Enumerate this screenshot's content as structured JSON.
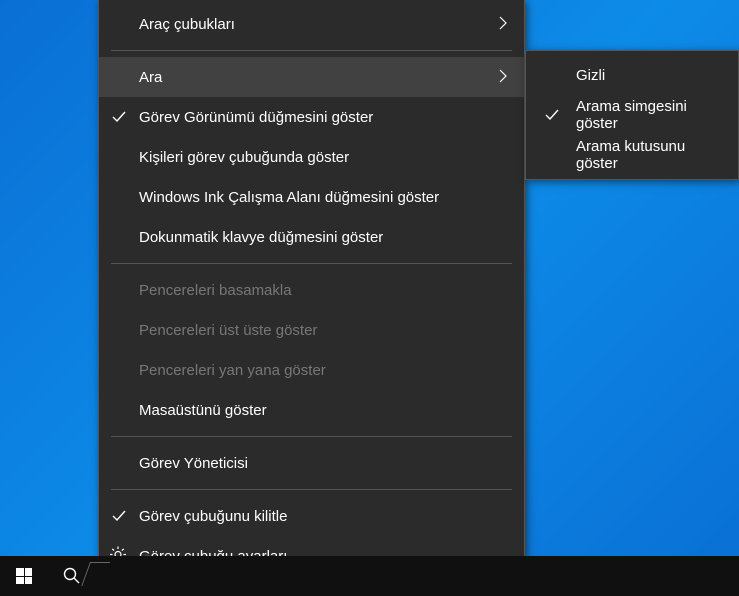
{
  "mainMenu": {
    "toolbars": "Araç çubukları",
    "search": "Ara",
    "showTaskView": "Görev Görünümü düğmesini göster",
    "showPeople": "Kişileri görev çubuğunda göster",
    "showInk": "Windows Ink Çalışma Alanı düğmesini göster",
    "showTouchKeyboard": "Dokunmatik klavye düğmesini göster",
    "cascadeWindows": "Pencereleri basamakla",
    "stackWindows": "Pencereleri üst üste göster",
    "sideBySide": "Pencereleri yan yana göster",
    "showDesktop": "Masaüstünü göster",
    "taskManager": "Görev Yöneticisi",
    "lockTaskbar": "Görev çubuğunu kilitle",
    "taskbarSettings": "Görev çubuğu ayarları"
  },
  "subMenu": {
    "hidden": "Gizli",
    "showIcon": "Arama simgesini göster",
    "showBox": "Arama kutusunu göster"
  }
}
